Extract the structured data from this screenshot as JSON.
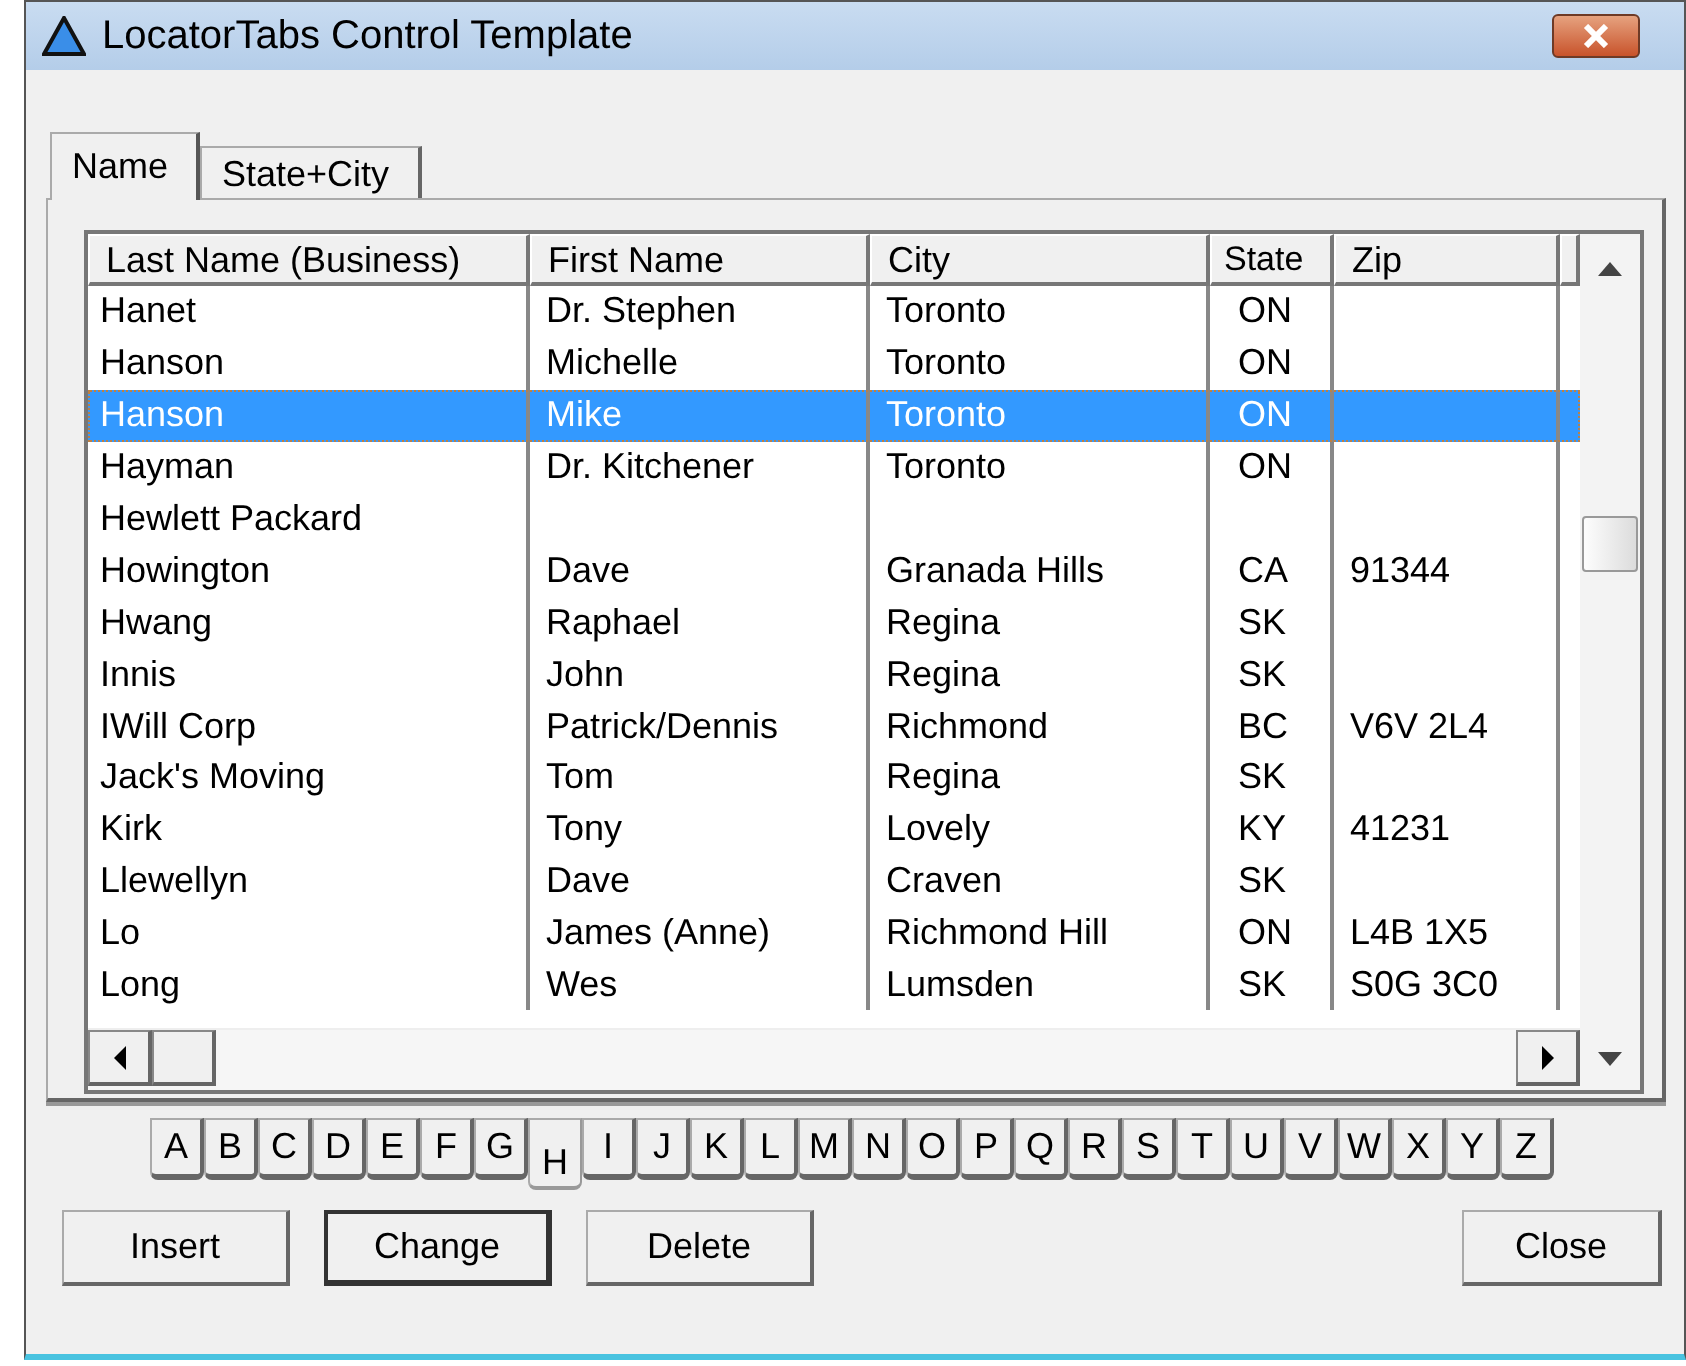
{
  "window": {
    "title": "LocatorTabs Control Template"
  },
  "tabs": [
    {
      "label": "Name",
      "selected": true
    },
    {
      "label": "State+City",
      "selected": false
    }
  ],
  "table": {
    "columns": [
      "Last Name (Business)",
      "First Name",
      "City",
      "State",
      "Zip"
    ],
    "rows": [
      {
        "cells": [
          "Hanet",
          "Dr. Stephen",
          "Toronto",
          "ON",
          ""
        ],
        "selected": false
      },
      {
        "cells": [
          "Hanson",
          "Michelle",
          "Toronto",
          "ON",
          ""
        ],
        "selected": false
      },
      {
        "cells": [
          "Hanson",
          "Mike",
          "Toronto",
          "ON",
          ""
        ],
        "selected": true
      },
      {
        "cells": [
          "Hayman",
          "Dr. Kitchener",
          "Toronto",
          "ON",
          ""
        ],
        "selected": false
      },
      {
        "cells": [
          "Hewlett Packard",
          "",
          "",
          "",
          ""
        ],
        "selected": false
      },
      {
        "cells": [
          "Howington",
          "Dave",
          "Granada Hills",
          "CA",
          "91344"
        ],
        "selected": false
      },
      {
        "cells": [
          "Hwang",
          "Raphael",
          "Regina",
          "SK",
          ""
        ],
        "selected": false
      },
      {
        "cells": [
          "Innis",
          "John",
          "Regina",
          "SK",
          ""
        ],
        "selected": false
      },
      {
        "cells": [
          "IWill Corp",
          "Patrick/Dennis",
          "Richmond",
          "BC",
          "V6V 2L4"
        ],
        "selected": false
      },
      {
        "cells": [
          "Jack's Moving",
          "Tom",
          "Regina",
          "SK",
          ""
        ],
        "selected": false
      },
      {
        "cells": [
          "Kirk",
          "Tony",
          "Lovely",
          "KY",
          "41231"
        ],
        "selected": false
      },
      {
        "cells": [
          "Llewellyn",
          "Dave",
          "Craven",
          "SK",
          ""
        ],
        "selected": false
      },
      {
        "cells": [
          "Lo",
          "James (Anne)",
          "Richmond Hill",
          "ON",
          "L4B 1X5"
        ],
        "selected": false
      },
      {
        "cells": [
          "Long",
          "Wes",
          "Lumsden",
          "SK",
          "S0G 3C0"
        ],
        "selected": false
      }
    ]
  },
  "letters": [
    {
      "label": "A",
      "selected": false
    },
    {
      "label": "B",
      "selected": false
    },
    {
      "label": "C",
      "selected": false
    },
    {
      "label": "D",
      "selected": false
    },
    {
      "label": "E",
      "selected": false
    },
    {
      "label": "F",
      "selected": false
    },
    {
      "label": "G",
      "selected": false
    },
    {
      "label": "H",
      "selected": true
    },
    {
      "label": "I",
      "selected": false
    },
    {
      "label": "J",
      "selected": false
    },
    {
      "label": "K",
      "selected": false
    },
    {
      "label": "L",
      "selected": false
    },
    {
      "label": "M",
      "selected": false
    },
    {
      "label": "N",
      "selected": false
    },
    {
      "label": "O",
      "selected": false
    },
    {
      "label": "P",
      "selected": false
    },
    {
      "label": "Q",
      "selected": false
    },
    {
      "label": "R",
      "selected": false
    },
    {
      "label": "S",
      "selected": false
    },
    {
      "label": "T",
      "selected": false
    },
    {
      "label": "U",
      "selected": false
    },
    {
      "label": "V",
      "selected": false
    },
    {
      "label": "W",
      "selected": false
    },
    {
      "label": "X",
      "selected": false
    },
    {
      "label": "Y",
      "selected": false
    },
    {
      "label": "Z",
      "selected": false
    }
  ],
  "buttons": [
    {
      "label": "Insert",
      "kind": "left",
      "default": false
    },
    {
      "label": "Change",
      "kind": "left",
      "default": true
    },
    {
      "label": "Delete",
      "kind": "left",
      "default": false
    },
    {
      "label": "Close",
      "kind": "right",
      "default": false
    }
  ]
}
